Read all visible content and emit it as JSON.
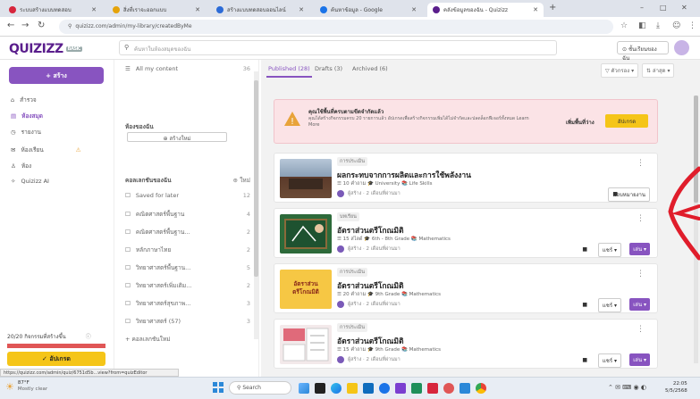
{
  "browser": {
    "tabs": [
      {
        "label": "ระบบสร้างแบบทดสอบ",
        "color": "#d7263d",
        "active": false
      },
      {
        "label": "สิ่งที่เราจะออกแบบ",
        "color": "#e5a30a",
        "active": false
      },
      {
        "label": "สร้างแบบทดสอบออนไลน์",
        "color": "#2c6bd7",
        "active": false
      },
      {
        "label": "ค้นหาข้อมูล - Google",
        "color": "#1a73e8",
        "active": false
      },
      {
        "label": "คลังข้อมูลของฉัน - Quizizz",
        "color": "#5a1e8c",
        "active": true
      }
    ],
    "url": "quizizz.com/admin/my-library/createdByMe",
    "window_controls": [
      "–",
      "□",
      "✕"
    ]
  },
  "header": {
    "logo": "QUIZIZZ",
    "logo_badge": "BASIC",
    "search_placeholder": "ค้นหาในห้องสมุดของฉัน",
    "classes_button": "ชั้นเรียนของฉัน"
  },
  "sidebar": {
    "create_label": "+ สร้าง",
    "items": [
      {
        "icon": "⌂",
        "label": "สำรวจ",
        "active": false
      },
      {
        "icon": "▤",
        "label": "ห้องสมุด",
        "active": true
      },
      {
        "icon": "◷",
        "label": "รายงาน",
        "active": false
      },
      {
        "icon": "✉",
        "label": "ห้องเรียน",
        "active": false
      },
      {
        "icon": "♙",
        "label": "ห้อง",
        "active": false
      },
      {
        "icon": "✧",
        "label": "Quizizz AI",
        "active": false
      }
    ],
    "storage_text": "20/20 กิจกรรมที่สร้างขึ้น",
    "upgrade_label": "✓ อัปเกรด",
    "upgrade_fill": 1.0
  },
  "folders": {
    "all_content_label": "All my content",
    "all_content_count": "36",
    "section_title": "ห้องของฉัน",
    "new_folder_label": "⊕ สร้างใหม่",
    "collections_title": "คอลเลกชันของฉัน",
    "new_collection_label": "⊕ ใหม่",
    "items": [
      {
        "label": "Saved for later",
        "count": "12"
      },
      {
        "label": "คณิตศาสตร์พื้นฐาน",
        "count": "4"
      },
      {
        "label": "คณิตศาสตร์พื้นฐาน...",
        "count": "2"
      },
      {
        "label": "หลักภาษาไทย",
        "count": "2"
      },
      {
        "label": "วิทยาศาสตร์พื้นฐาน...",
        "count": "5"
      },
      {
        "label": "วิทยาศาสตร์เพิ่มเติม...",
        "count": "2"
      },
      {
        "label": "วิทยาศาสตร์สุขภาพ...",
        "count": "3"
      },
      {
        "label": "วิทยาศาสตร์ (57)",
        "count": "3"
      }
    ],
    "more_label": "+ คอลเลกชันใหม่"
  },
  "main": {
    "tabs": [
      {
        "label": "Published (28)",
        "active": true
      },
      {
        "label": "Drafts (3)",
        "active": false
      },
      {
        "label": "Archived (6)",
        "active": false
      }
    ],
    "filter_label": "▽ ตัวกรอง ▾",
    "sort_label": "⇅ ล่าสุด ▾",
    "banner": {
      "title": "คุณใช้พื้นที่ครบตามขีดจำกัดแล้ว",
      "body": "คุณได้สร้างกิจกรรมครบ 20 รายการแล้ว อัปเกรดเพื่อสร้างกิจกรรมเพิ่มได้ไม่จำกัดและปลดล็อกฟีเจอร์ทั้งหมด Learn More",
      "link_label": "เพิ่มพื้นที่ว่าง",
      "button_label": "อัปเกรด"
    },
    "cards": [
      {
        "tag": "การประเมิน",
        "title": "ผลกระทบจากการผลิตและการใช้พลังงาน",
        "meta": "☰ 10 คำถาม  🎓 University  📚 Life Skills",
        "author": "ผู้สร้าง · 2 เดือนที่ผ่านมา",
        "actions": "มอบหมายงาน",
        "has_play": false,
        "thumb": "classroom"
      },
      {
        "tag": "บทเรียน",
        "title": "อัตราส่วนตรีโกณมิติ",
        "meta": "☰ 15 สไลด์  🎓 6th - 8th Grade  📚 Mathematics",
        "author": "ผู้สร้าง · 2 เดือนที่ผ่านมา",
        "actions": "แชร์ ▾",
        "has_play": true,
        "thumb": "chalkboard"
      },
      {
        "tag": "การประเมิน",
        "title": "อัตราส่วนตรีโกณมิติ",
        "meta": "☰ 20 คำถาม  🎓 9th Grade  📚 Mathematics",
        "author": "ผู้สร้าง · 2 เดือนที่ผ่านมา",
        "actions": "แชร์ ▾",
        "has_play": true,
        "thumb": "yellow",
        "thumb_text": "อัตราส่วนตรีโกณมิติ"
      },
      {
        "tag": "การประเมิน",
        "title": "อัตราส่วนตรีโกณมิติ",
        "meta": "☰ 15 คำถาม  🎓 9th Grade  📚 Mathematics",
        "author": "ผู้สร้าง · 2 เดือนที่ผ่านมา",
        "actions": "แชร์ ▾",
        "has_play": true,
        "thumb": "worksheet"
      }
    ],
    "play_label": "เล่น ▾"
  },
  "status": {
    "hover_url": "https://quizizz.com/admin/quiz/6751d5b...view?from=quizEditor",
    "weather_temp": "87°F",
    "weather_desc": "Mostly clear",
    "taskbar_search": "Search",
    "time": "22:05",
    "date": "5/5/2568"
  }
}
